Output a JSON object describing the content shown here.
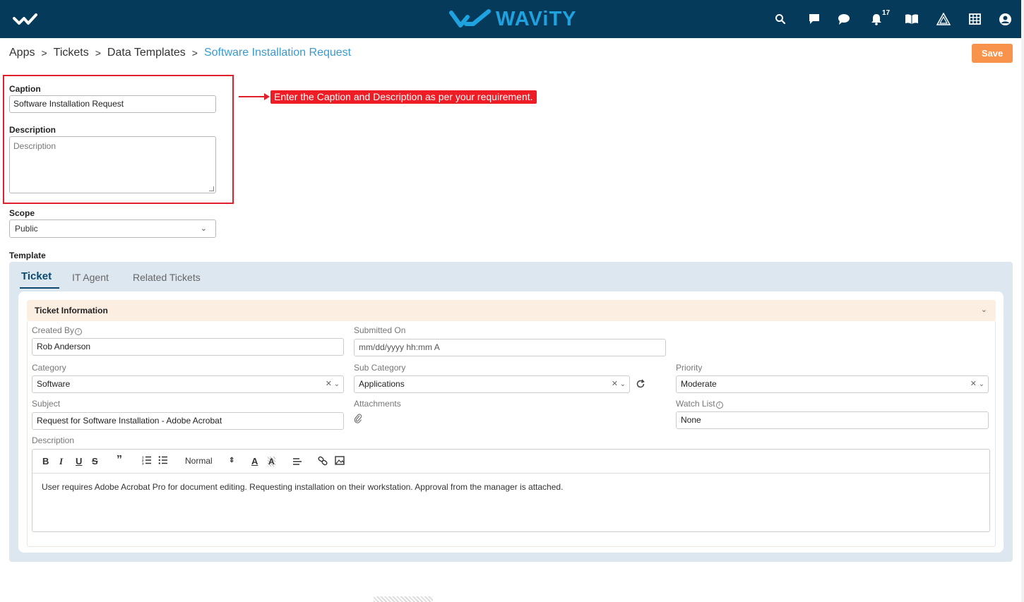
{
  "header": {
    "logo_text": "WAViTY",
    "notification_count": "17",
    "icons": [
      "search-icon",
      "chat-square-icon",
      "chat-bubble-icon",
      "bell-icon",
      "book-icon",
      "triangle-logo-icon",
      "grid-icon",
      "user-icon"
    ]
  },
  "breadcrumb": {
    "items": [
      "Apps",
      "Tickets",
      "Data Templates"
    ],
    "separator": ">",
    "current": "Software Installation Request"
  },
  "toolbar": {
    "save_label": "Save"
  },
  "annotation": {
    "text": "Enter the Caption and Description as per your requirement."
  },
  "form": {
    "caption_label": "Caption",
    "caption_value": "Software Installation Request",
    "description_label": "Description",
    "description_placeholder": "Description",
    "scope_label": "Scope",
    "scope_value": "Public",
    "template_label": "Template"
  },
  "tabs": [
    {
      "label": "Ticket",
      "active": true
    },
    {
      "label": "IT Agent",
      "active": false
    },
    {
      "label": "Related Tickets",
      "active": false
    }
  ],
  "ticket_info": {
    "section_title": "Ticket Information",
    "created_by_label": "Created By",
    "created_by_value": "Rob Anderson",
    "submitted_on_label": "Submitted On",
    "submitted_on_placeholder": "mm/dd/yyyy hh:mm A",
    "category_label": "Category",
    "category_value": "Software",
    "sub_category_label": "Sub Category",
    "sub_category_value": "Applications",
    "priority_label": "Priority",
    "priority_value": "Moderate",
    "subject_label": "Subject",
    "subject_value": "Request for Software Installation - Adobe Acrobat",
    "attachments_label": "Attachments",
    "watch_list_label": "Watch List",
    "watch_list_value": "None",
    "description_label": "Description",
    "editor_format": "Normal",
    "editor_content": "User requires Adobe Acrobat Pro for document editing. Requesting installation on their workstation. Approval from the manager is attached."
  },
  "colors": {
    "header_bg": "#063a5a",
    "logo": "#1fa3e0",
    "accent_link": "#3a9ad0",
    "save_button": "#f7934a",
    "highlight": "#e0202a",
    "section_head": "#fcefe1",
    "template_panel": "#dde7ef"
  }
}
